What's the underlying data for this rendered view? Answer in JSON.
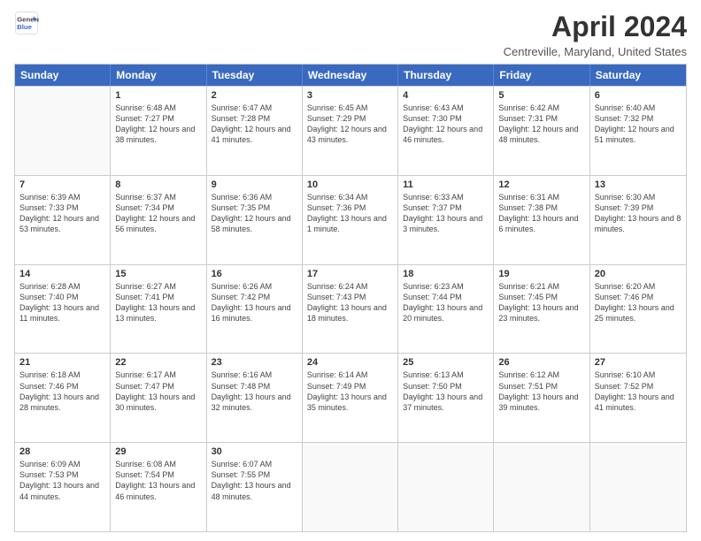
{
  "header": {
    "logo_line1": "General",
    "logo_line2": "Blue",
    "month_year": "April 2024",
    "location": "Centreville, Maryland, United States"
  },
  "calendar": {
    "days_of_week": [
      "Sunday",
      "Monday",
      "Tuesday",
      "Wednesday",
      "Thursday",
      "Friday",
      "Saturday"
    ],
    "weeks": [
      [
        {
          "day": "",
          "sunrise": "",
          "sunset": "",
          "daylight": "",
          "empty": true
        },
        {
          "day": "1",
          "sunrise": "Sunrise: 6:48 AM",
          "sunset": "Sunset: 7:27 PM",
          "daylight": "Daylight: 12 hours and 38 minutes."
        },
        {
          "day": "2",
          "sunrise": "Sunrise: 6:47 AM",
          "sunset": "Sunset: 7:28 PM",
          "daylight": "Daylight: 12 hours and 41 minutes."
        },
        {
          "day": "3",
          "sunrise": "Sunrise: 6:45 AM",
          "sunset": "Sunset: 7:29 PM",
          "daylight": "Daylight: 12 hours and 43 minutes."
        },
        {
          "day": "4",
          "sunrise": "Sunrise: 6:43 AM",
          "sunset": "Sunset: 7:30 PM",
          "daylight": "Daylight: 12 hours and 46 minutes."
        },
        {
          "day": "5",
          "sunrise": "Sunrise: 6:42 AM",
          "sunset": "Sunset: 7:31 PM",
          "daylight": "Daylight: 12 hours and 48 minutes."
        },
        {
          "day": "6",
          "sunrise": "Sunrise: 6:40 AM",
          "sunset": "Sunset: 7:32 PM",
          "daylight": "Daylight: 12 hours and 51 minutes."
        }
      ],
      [
        {
          "day": "7",
          "sunrise": "Sunrise: 6:39 AM",
          "sunset": "Sunset: 7:33 PM",
          "daylight": "Daylight: 12 hours and 53 minutes."
        },
        {
          "day": "8",
          "sunrise": "Sunrise: 6:37 AM",
          "sunset": "Sunset: 7:34 PM",
          "daylight": "Daylight: 12 hours and 56 minutes."
        },
        {
          "day": "9",
          "sunrise": "Sunrise: 6:36 AM",
          "sunset": "Sunset: 7:35 PM",
          "daylight": "Daylight: 12 hours and 58 minutes."
        },
        {
          "day": "10",
          "sunrise": "Sunrise: 6:34 AM",
          "sunset": "Sunset: 7:36 PM",
          "daylight": "Daylight: 13 hours and 1 minute."
        },
        {
          "day": "11",
          "sunrise": "Sunrise: 6:33 AM",
          "sunset": "Sunset: 7:37 PM",
          "daylight": "Daylight: 13 hours and 3 minutes."
        },
        {
          "day": "12",
          "sunrise": "Sunrise: 6:31 AM",
          "sunset": "Sunset: 7:38 PM",
          "daylight": "Daylight: 13 hours and 6 minutes."
        },
        {
          "day": "13",
          "sunrise": "Sunrise: 6:30 AM",
          "sunset": "Sunset: 7:39 PM",
          "daylight": "Daylight: 13 hours and 8 minutes."
        }
      ],
      [
        {
          "day": "14",
          "sunrise": "Sunrise: 6:28 AM",
          "sunset": "Sunset: 7:40 PM",
          "daylight": "Daylight: 13 hours and 11 minutes."
        },
        {
          "day": "15",
          "sunrise": "Sunrise: 6:27 AM",
          "sunset": "Sunset: 7:41 PM",
          "daylight": "Daylight: 13 hours and 13 minutes."
        },
        {
          "day": "16",
          "sunrise": "Sunrise: 6:26 AM",
          "sunset": "Sunset: 7:42 PM",
          "daylight": "Daylight: 13 hours and 16 minutes."
        },
        {
          "day": "17",
          "sunrise": "Sunrise: 6:24 AM",
          "sunset": "Sunset: 7:43 PM",
          "daylight": "Daylight: 13 hours and 18 minutes."
        },
        {
          "day": "18",
          "sunrise": "Sunrise: 6:23 AM",
          "sunset": "Sunset: 7:44 PM",
          "daylight": "Daylight: 13 hours and 20 minutes."
        },
        {
          "day": "19",
          "sunrise": "Sunrise: 6:21 AM",
          "sunset": "Sunset: 7:45 PM",
          "daylight": "Daylight: 13 hours and 23 minutes."
        },
        {
          "day": "20",
          "sunrise": "Sunrise: 6:20 AM",
          "sunset": "Sunset: 7:46 PM",
          "daylight": "Daylight: 13 hours and 25 minutes."
        }
      ],
      [
        {
          "day": "21",
          "sunrise": "Sunrise: 6:18 AM",
          "sunset": "Sunset: 7:46 PM",
          "daylight": "Daylight: 13 hours and 28 minutes."
        },
        {
          "day": "22",
          "sunrise": "Sunrise: 6:17 AM",
          "sunset": "Sunset: 7:47 PM",
          "daylight": "Daylight: 13 hours and 30 minutes."
        },
        {
          "day": "23",
          "sunrise": "Sunrise: 6:16 AM",
          "sunset": "Sunset: 7:48 PM",
          "daylight": "Daylight: 13 hours and 32 minutes."
        },
        {
          "day": "24",
          "sunrise": "Sunrise: 6:14 AM",
          "sunset": "Sunset: 7:49 PM",
          "daylight": "Daylight: 13 hours and 35 minutes."
        },
        {
          "day": "25",
          "sunrise": "Sunrise: 6:13 AM",
          "sunset": "Sunset: 7:50 PM",
          "daylight": "Daylight: 13 hours and 37 minutes."
        },
        {
          "day": "26",
          "sunrise": "Sunrise: 6:12 AM",
          "sunset": "Sunset: 7:51 PM",
          "daylight": "Daylight: 13 hours and 39 minutes."
        },
        {
          "day": "27",
          "sunrise": "Sunrise: 6:10 AM",
          "sunset": "Sunset: 7:52 PM",
          "daylight": "Daylight: 13 hours and 41 minutes."
        }
      ],
      [
        {
          "day": "28",
          "sunrise": "Sunrise: 6:09 AM",
          "sunset": "Sunset: 7:53 PM",
          "daylight": "Daylight: 13 hours and 44 minutes."
        },
        {
          "day": "29",
          "sunrise": "Sunrise: 6:08 AM",
          "sunset": "Sunset: 7:54 PM",
          "daylight": "Daylight: 13 hours and 46 minutes."
        },
        {
          "day": "30",
          "sunrise": "Sunrise: 6:07 AM",
          "sunset": "Sunset: 7:55 PM",
          "daylight": "Daylight: 13 hours and 48 minutes."
        },
        {
          "day": "",
          "sunrise": "",
          "sunset": "",
          "daylight": "",
          "empty": true
        },
        {
          "day": "",
          "sunrise": "",
          "sunset": "",
          "daylight": "",
          "empty": true
        },
        {
          "day": "",
          "sunrise": "",
          "sunset": "",
          "daylight": "",
          "empty": true
        },
        {
          "day": "",
          "sunrise": "",
          "sunset": "",
          "daylight": "",
          "empty": true
        }
      ]
    ]
  }
}
